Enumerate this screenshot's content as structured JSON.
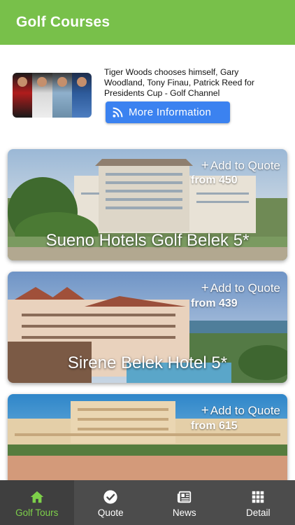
{
  "header": {
    "title": "Golf Courses"
  },
  "news": {
    "headline": "Tiger Woods chooses himself, Gary Woodland, Tony Finau, Patrick Reed for Presidents Cup - Golf Channel",
    "button_label": "More Information",
    "thumb_icon": "players-photo"
  },
  "hotels": [
    {
      "name": "Sueno Hotels Golf Belek 5*",
      "price": "from 450",
      "quote_label": "Add to Quote"
    },
    {
      "name": "Sirene Belek Hotel 5*",
      "price": "from 439",
      "quote_label": "Add to Quote"
    },
    {
      "name": "",
      "price": "from 615",
      "quote_label": "Add to Quote"
    }
  ],
  "tabs": [
    {
      "label": "Golf Tours",
      "icon": "home-icon",
      "active": true
    },
    {
      "label": "Quote",
      "icon": "check-circle-icon",
      "active": false
    },
    {
      "label": "News",
      "icon": "newspaper-icon",
      "active": false
    },
    {
      "label": "Detail",
      "icon": "grid-icon",
      "active": false
    }
  ],
  "colors": {
    "header": "#78c04a",
    "button": "#3b82f0",
    "tabbar": "#4c4c4c",
    "active_tab": "#7ed14a"
  }
}
